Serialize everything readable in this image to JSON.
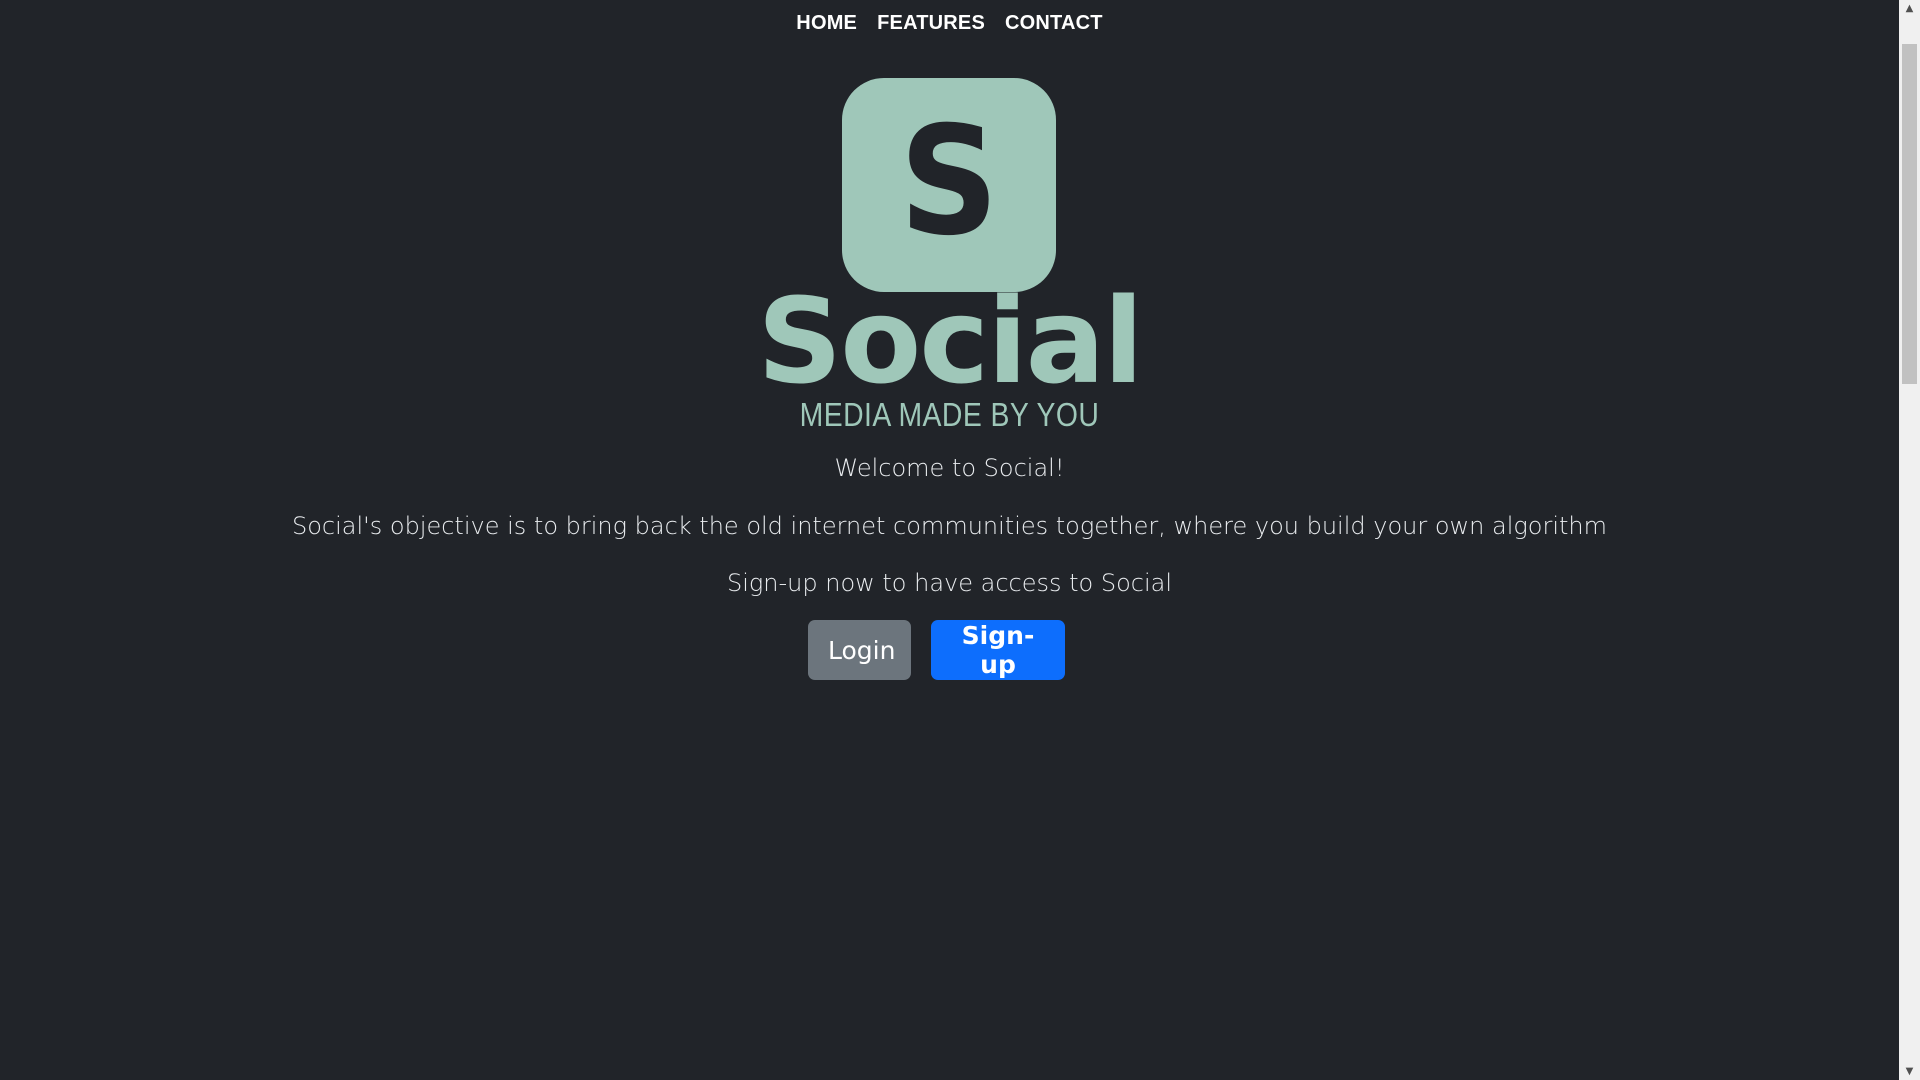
{
  "nav": {
    "items": [
      {
        "label": "HOME"
      },
      {
        "label": "FEATURES"
      },
      {
        "label": "CONTACT"
      }
    ]
  },
  "brand": {
    "logo_letter": "S",
    "name": "Social",
    "tagline": "MEDIA MADE BY YOU",
    "logo_color": "#9fc7b9"
  },
  "content": {
    "welcome": "Welcome to Social!",
    "objective": "Social's objective is to bring back the old internet communities together, where you build your own algorithm",
    "cta_text": "Sign-up now to have access to Social"
  },
  "buttons": {
    "login_label": "Login",
    "signup_label": "Sign-up"
  },
  "colors": {
    "background": "#212429",
    "accent": "#9fc7b9",
    "primary_button": "#0d6efd",
    "secondary_button": "#6c757d"
  },
  "scrollbar": {
    "up_icon": "triangle-up-icon",
    "down_icon": "triangle-down-icon"
  }
}
